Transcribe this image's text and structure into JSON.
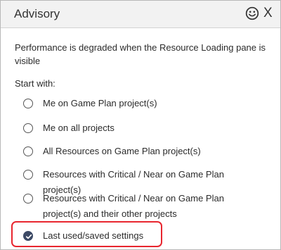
{
  "dialog": {
    "title": "Advisory",
    "feedback_icon": "smiley-face-icon",
    "close_label": "X"
  },
  "message": "Performance is degraded when the Resource Loading pane is visible",
  "start_with_label": "Start with:",
  "options": [
    {
      "label": "Me on Game Plan project(s)",
      "selected": false
    },
    {
      "label": "Me on all projects",
      "selected": false
    },
    {
      "label": "All Resources on Game Plan project(s)",
      "selected": false
    },
    {
      "label": "Resources with Critical / Near on Game Plan project(s)",
      "selected": false
    },
    {
      "label": "Resources with Critical / Near on Game Plan project(s) and their other projects",
      "selected": false
    },
    {
      "label": "Last used/saved settings",
      "selected": true
    }
  ],
  "colors": {
    "header_bg": "#f2f2f2",
    "selected_radio": "#3d4a66",
    "highlight_border": "#e8262f"
  }
}
